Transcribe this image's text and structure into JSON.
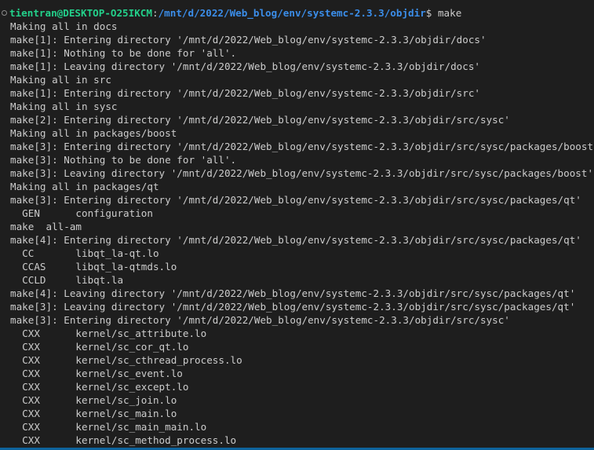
{
  "prompt": {
    "user_host": "tientran@DESKTOP-O25IKCM",
    "separator": ":",
    "cwd": "/mnt/d/2022/Web_blog/env/systemc-2.3.3/objdir",
    "symbol": "$ ",
    "command": "make"
  },
  "output": [
    "Making all in docs",
    "make[1]: Entering directory '/mnt/d/2022/Web_blog/env/systemc-2.3.3/objdir/docs'",
    "make[1]: Nothing to be done for 'all'.",
    "make[1]: Leaving directory '/mnt/d/2022/Web_blog/env/systemc-2.3.3/objdir/docs'",
    "Making all in src",
    "make[1]: Entering directory '/mnt/d/2022/Web_blog/env/systemc-2.3.3/objdir/src'",
    "Making all in sysc",
    "make[2]: Entering directory '/mnt/d/2022/Web_blog/env/systemc-2.3.3/objdir/src/sysc'",
    "Making all in packages/boost",
    "make[3]: Entering directory '/mnt/d/2022/Web_blog/env/systemc-2.3.3/objdir/src/sysc/packages/boost'",
    "make[3]: Nothing to be done for 'all'.",
    "make[3]: Leaving directory '/mnt/d/2022/Web_blog/env/systemc-2.3.3/objdir/src/sysc/packages/boost'",
    "Making all in packages/qt",
    "make[3]: Entering directory '/mnt/d/2022/Web_blog/env/systemc-2.3.3/objdir/src/sysc/packages/qt'",
    "  GEN      configuration",
    "make  all-am",
    "make[4]: Entering directory '/mnt/d/2022/Web_blog/env/systemc-2.3.3/objdir/src/sysc/packages/qt'",
    "  CC       libqt_la-qt.lo",
    "  CCAS     libqt_la-qtmds.lo",
    "  CCLD     libqt.la",
    "make[4]: Leaving directory '/mnt/d/2022/Web_blog/env/systemc-2.3.3/objdir/src/sysc/packages/qt'",
    "make[3]: Leaving directory '/mnt/d/2022/Web_blog/env/systemc-2.3.3/objdir/src/sysc/packages/qt'",
    "make[3]: Entering directory '/mnt/d/2022/Web_blog/env/systemc-2.3.3/objdir/src/sysc'",
    "  CXX      kernel/sc_attribute.lo",
    "  CXX      kernel/sc_cor_qt.lo",
    "  CXX      kernel/sc_cthread_process.lo",
    "  CXX      kernel/sc_event.lo",
    "  CXX      kernel/sc_except.lo",
    "  CXX      kernel/sc_join.lo",
    "  CXX      kernel/sc_main.lo",
    "  CXX      kernel/sc_main_main.lo",
    "  CXX      kernel/sc_method_process.lo"
  ]
}
